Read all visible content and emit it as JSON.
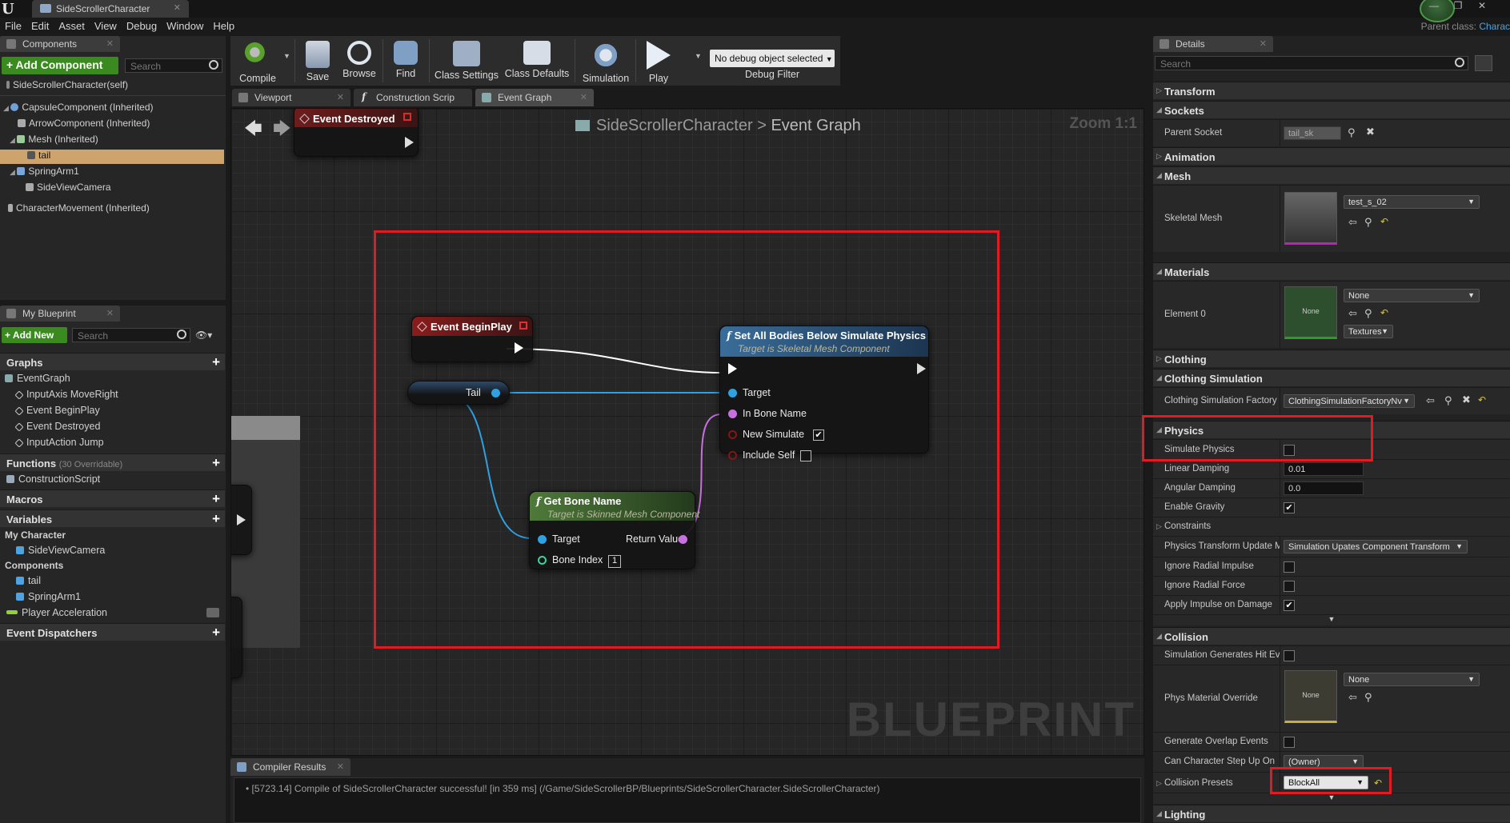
{
  "window": {
    "tab_title": "SideScrollerCharacter",
    "parent_class_label": "Parent class:",
    "parent_class_value": "Charac"
  },
  "menu": [
    "File",
    "Edit",
    "Asset",
    "View",
    "Debug",
    "Window",
    "Help"
  ],
  "components_panel": {
    "tab_label": "Components",
    "add_button": "+ Add Component",
    "search_placeholder": "Search",
    "self_label": "SideScrollerCharacter(self)",
    "items": [
      {
        "label": "CapsuleComponent (Inherited)"
      },
      {
        "label": "ArrowComponent (Inherited)"
      },
      {
        "label": "Mesh (Inherited)"
      },
      {
        "label": "tail"
      },
      {
        "label": "SpringArm1"
      },
      {
        "label": "SideViewCamera"
      },
      {
        "label": "CharacterMovement (Inherited)"
      }
    ]
  },
  "my_blueprint": {
    "tab_label": "My Blueprint",
    "add_button": "+ Add New",
    "search_placeholder": "Search",
    "graphs_header": "Graphs",
    "graphs": [
      "EventGraph",
      "InputAxis MoveRight",
      "Event BeginPlay",
      "Event Destroyed",
      "InputAction Jump"
    ],
    "functions_header": "Functions",
    "functions_count": "(30 Overridable)",
    "functions": [
      "ConstructionScript"
    ],
    "macros_header": "Macros",
    "variables_header": "Variables",
    "my_character_label": "My Character",
    "my_character_items": [
      "SideViewCamera"
    ],
    "components_label": "Components",
    "component_vars": [
      "tail",
      "SpringArm1"
    ],
    "player_accel": "Player Acceleration",
    "dispatchers_header": "Event Dispatchers"
  },
  "toolbar": {
    "buttons": [
      "Compile",
      "Save",
      "Browse",
      "Find",
      "Class Settings",
      "Class Defaults",
      "Simulation",
      "Play"
    ],
    "debug_object": "No debug object selected",
    "debug_filter": "Debug Filter"
  },
  "editor_tabs": [
    "Viewport",
    "Construction Scrip",
    "Event Graph"
  ],
  "graph": {
    "breadcrumb_root": "SideScrollerCharacter",
    "breadcrumb_sep": ">",
    "breadcrumb_leaf": "Event Graph",
    "zoom": "Zoom 1:1",
    "watermark": "BLUEPRINT",
    "node_event_destroyed": "Event Destroyed",
    "node_begin_play": "Event BeginPlay",
    "node_tail": "Tail",
    "node_set_bodies": {
      "title": "Set All Bodies Below Simulate Physics",
      "subtitle": "Target is Skeletal Mesh Component",
      "pin_target": "Target",
      "pin_bone": "In Bone Name",
      "pin_new_sim": "New Simulate",
      "pin_include_self": "Include Self"
    },
    "node_get_bone": {
      "title": "Get Bone Name",
      "subtitle": "Target is Skinned Mesh Component",
      "pin_target": "Target",
      "pin_return": "Return Value",
      "pin_bone_index": "Bone Index",
      "bone_index_value": "1"
    }
  },
  "compiler": {
    "tab_label": "Compiler Results",
    "message": "[5723.14] Compile of SideScrollerCharacter successful! [in 359 ms] (/Game/SideScrollerBP/Blueprints/SideScrollerCharacter.SideScrollerCharacter)"
  },
  "details": {
    "tab_label": "Details",
    "search_placeholder": "Search",
    "transform": "Transform",
    "sockets": "Sockets",
    "parent_socket_label": "Parent Socket",
    "parent_socket_value": "tail_sk",
    "animation": "Animation",
    "mesh": "Mesh",
    "skeletal_mesh_label": "Skeletal Mesh",
    "skeletal_mesh_value": "test_s_02",
    "materials": "Materials",
    "element0_label": "Element 0",
    "element0_value": "None",
    "none_thumb": "None",
    "textures_btn": "Textures",
    "clothing": "Clothing",
    "clothing_sim": "Clothing Simulation",
    "clothing_factory_label": "Clothing Simulation Factory",
    "clothing_factory_value": "ClothingSimulationFactoryNv",
    "physics": "Physics",
    "simulate_physics": "Simulate Physics",
    "linear_damping_label": "Linear Damping",
    "linear_damping": "0.01",
    "angular_damping_label": "Angular Damping",
    "angular_damping": "0.0",
    "enable_gravity": "Enable Gravity",
    "constraints": "Constraints",
    "phys_transform_label": "Physics Transform Update M",
    "phys_transform_value": "Simulation Upates Component Transform",
    "ignore_radial_impulse": "Ignore Radial Impulse",
    "ignore_radial_force": "Ignore Radial Force",
    "apply_impulse_damage": "Apply Impulse on Damage",
    "collision": "Collision",
    "sim_hit_events": "Simulation Generates Hit Eve",
    "phys_mat_label": "Phys Material Override",
    "phys_mat_value": "None",
    "gen_overlap": "Generate Overlap Events",
    "step_up_label": "Can Character Step Up On",
    "step_up_value": "(Owner)",
    "collision_presets_label": "Collision Presets",
    "collision_presets_value": "BlockAll",
    "lighting": "Lighting"
  }
}
